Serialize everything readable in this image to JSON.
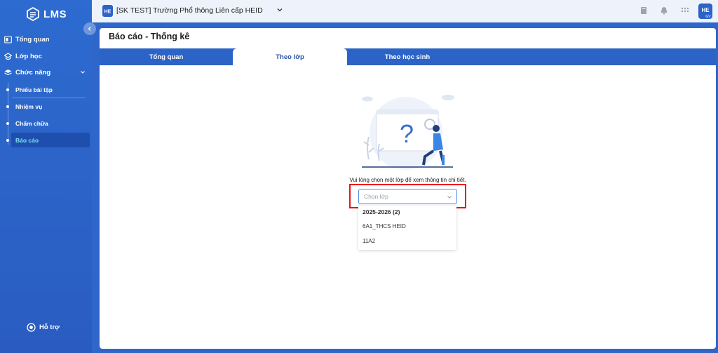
{
  "app": {
    "name": "LMS"
  },
  "sidebar": {
    "items": [
      {
        "label": "Tổng quan",
        "icon": "dashboard-icon"
      },
      {
        "label": "Lớp học",
        "icon": "class-icon"
      },
      {
        "label": "Chức năng",
        "icon": "layers-icon"
      }
    ],
    "subitems": [
      {
        "label": "Phiếu bài tập"
      },
      {
        "label": "Nhiệm vụ"
      },
      {
        "label": "Chấm chữa"
      },
      {
        "label": "Báo cáo"
      }
    ],
    "support_label": "Hỗ trợ"
  },
  "topbar": {
    "school_name": "[SK TEST] Trường Phổ thông Liên cấp HEID"
  },
  "page": {
    "title": "Báo cáo - Thống kê"
  },
  "tabs": [
    {
      "label": "Tổng quan"
    },
    {
      "label": "Theo lớp"
    },
    {
      "label": "Theo học sinh"
    }
  ],
  "empty_state": {
    "message": "Vui lòng chọn một lớp để xem thông tin chi tiết."
  },
  "class_select": {
    "placeholder": "Chọn lớp",
    "group_label": "2025-2026 (2)",
    "options": [
      "6A1_THCS HEID",
      "11A2"
    ]
  },
  "colors": {
    "primary": "#2c63c7",
    "highlight": "#e11111",
    "active_sub": "#1f4fae"
  }
}
